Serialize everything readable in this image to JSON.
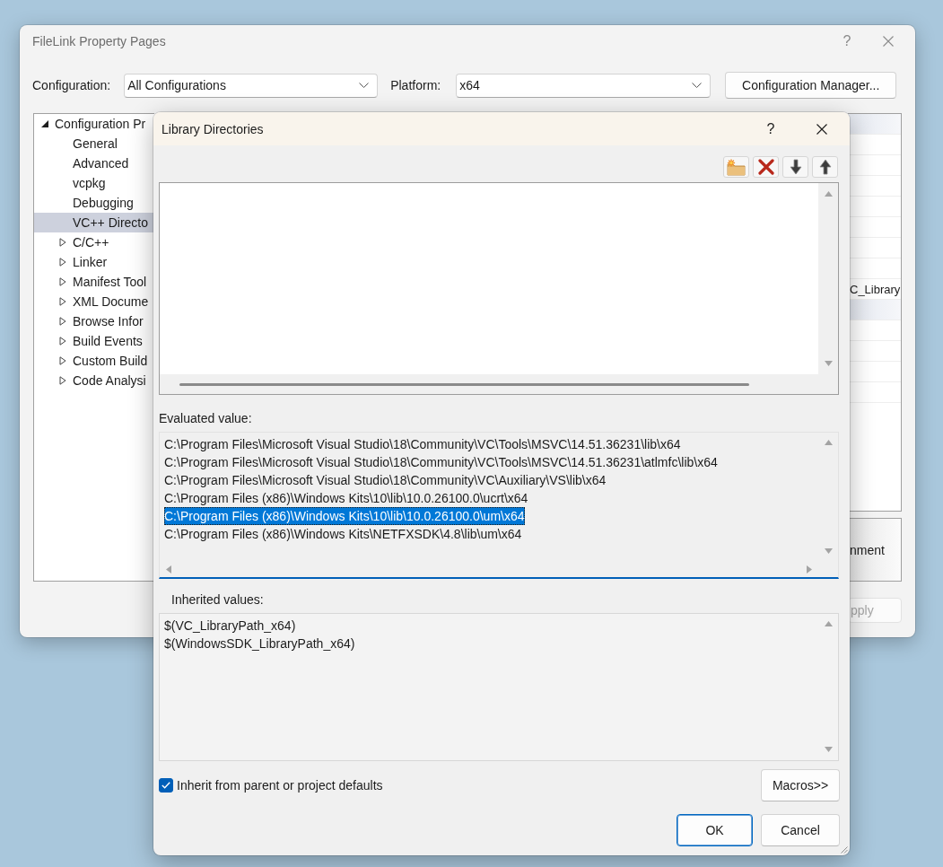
{
  "window": {
    "title": "FileLink Property Pages",
    "help_label": "?"
  },
  "config_bar": {
    "configuration_label": "Configuration:",
    "configuration_value": "All Configurations",
    "platform_label": "Platform:",
    "platform_value": "x64",
    "manager_button": "Configuration Manager..."
  },
  "tree": {
    "items": [
      {
        "label": "Configuration Pr",
        "kind": "folder",
        "expanded": true,
        "selected": false,
        "children": [
          {
            "label": "General",
            "kind": "page",
            "selected": false
          },
          {
            "label": "Advanced",
            "kind": "page",
            "selected": false
          },
          {
            "label": "vcpkg",
            "kind": "page",
            "selected": false
          },
          {
            "label": "Debugging",
            "kind": "page",
            "selected": false
          },
          {
            "label": "VC++ Directo",
            "kind": "page",
            "selected": true
          },
          {
            "label": "C/C++",
            "kind": "folder",
            "expanded": false,
            "selected": false
          },
          {
            "label": "Linker",
            "kind": "folder",
            "expanded": false,
            "selected": false
          },
          {
            "label": "Manifest Tool",
            "kind": "folder",
            "expanded": false,
            "selected": false
          },
          {
            "label": "XML Docume",
            "kind": "folder",
            "expanded": false,
            "selected": false
          },
          {
            "label": "Browse Infor",
            "kind": "folder",
            "expanded": false,
            "selected": false
          },
          {
            "label": "Build Events",
            "kind": "folder",
            "expanded": false,
            "selected": false
          },
          {
            "label": "Custom Build",
            "kind": "folder",
            "expanded": false,
            "selected": false
          },
          {
            "label": "Code Analysi",
            "kind": "folder",
            "expanded": false,
            "selected": false
          }
        ]
      }
    ]
  },
  "property_grid": {
    "rows": [
      {
        "kind": "category"
      },
      {
        "kind": "property"
      },
      {
        "kind": "property"
      },
      {
        "kind": "property"
      },
      {
        "kind": "property"
      },
      {
        "kind": "property"
      },
      {
        "kind": "property"
      },
      {
        "kind": "property"
      },
      {
        "kind": "property",
        "value": "C_Library"
      },
      {
        "kind": "category"
      },
      {
        "kind": "property"
      },
      {
        "kind": "property"
      },
      {
        "kind": "property"
      },
      {
        "kind": "property"
      }
    ]
  },
  "description": {
    "text": "nment"
  },
  "apply_button": {
    "label": "pply",
    "disabled": true
  },
  "dialog": {
    "title": "Library Directories",
    "help_label": "?",
    "toolbar": [
      {
        "kind": "new"
      },
      {
        "kind": "delete"
      },
      {
        "kind": "move_down"
      },
      {
        "kind": "move_up"
      }
    ],
    "evaluated": {
      "label": "Evaluated value:",
      "lines": [
        {
          "text": "C:\\Program Files\\Microsoft Visual Studio\\18\\Community\\VC\\Tools\\MSVC\\14.51.36231\\lib\\x64",
          "selected": false
        },
        {
          "text": "C:\\Program Files\\Microsoft Visual Studio\\18\\Community\\VC\\Tools\\MSVC\\14.51.36231\\atlmfc\\lib\\x64",
          "selected": false
        },
        {
          "text": "C:\\Program Files\\Microsoft Visual Studio\\18\\Community\\VC\\Auxiliary\\VS\\lib\\x64",
          "selected": false
        },
        {
          "text": "C:\\Program Files (x86)\\Windows Kits\\10\\lib\\10.0.26100.0\\ucrt\\x64",
          "selected": false
        },
        {
          "text": "C:\\Program Files (x86)\\Windows Kits\\10\\lib\\10.0.26100.0\\um\\x64",
          "selected": true
        },
        {
          "text": "C:\\Program Files (x86)\\Windows Kits\\NETFXSDK\\4.8\\lib\\um\\x64",
          "selected": false
        }
      ]
    },
    "inherited": {
      "label": "Inherited values:",
      "lines": [
        "$(VC_LibraryPath_x64)",
        "$(WindowsSDK_LibraryPath_x64)"
      ]
    },
    "inherit_checkbox": {
      "label": "Inherit from parent or project defaults",
      "checked": true
    },
    "macros_button": "Macros>>",
    "buttons": [
      {
        "label": "OK",
        "default": true
      },
      {
        "label": "Cancel",
        "default": false
      }
    ]
  }
}
